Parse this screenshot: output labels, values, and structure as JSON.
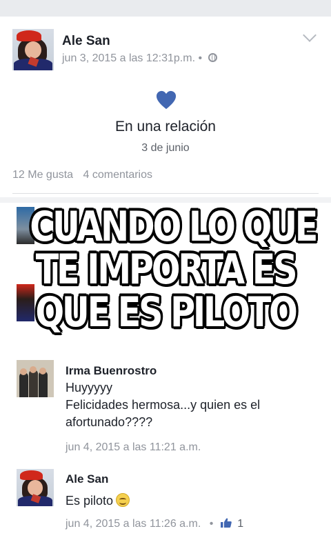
{
  "post": {
    "author": "Ale San",
    "timestamp": "jun 3, 2015 a las 12:31p.m.",
    "separator": "•",
    "event_text": "En una relación",
    "event_date": "3 de junio",
    "likes": "12 Me gusta",
    "comments": "4 comentarios"
  },
  "meme": {
    "lines": [
      "CUANDO LO QUE",
      "TE IMPORTA ES",
      "QUE ES PILOTO"
    ]
  },
  "comments": [
    {
      "author": "Irma Buenrostro",
      "line1": "Huyyyyy",
      "line2": "Felicidades hermosa...y quien es el",
      "line3": "afortunado????",
      "timestamp": "jun 4, 2015 a las 11:21 a.m."
    },
    {
      "author": "Ale San",
      "text": "Es piloto",
      "timestamp": "jun 4, 2015 a las 11:26 a.m.",
      "separator": "•",
      "like_count": "1"
    }
  ],
  "colors": {
    "heart": "#4267b2",
    "meta_gray": "#90949c",
    "background": "#e9ebee"
  },
  "icons": [
    "globe-icon",
    "chevron-down-icon",
    "heart-icon",
    "smile-emoji-icon",
    "like-icon"
  ]
}
